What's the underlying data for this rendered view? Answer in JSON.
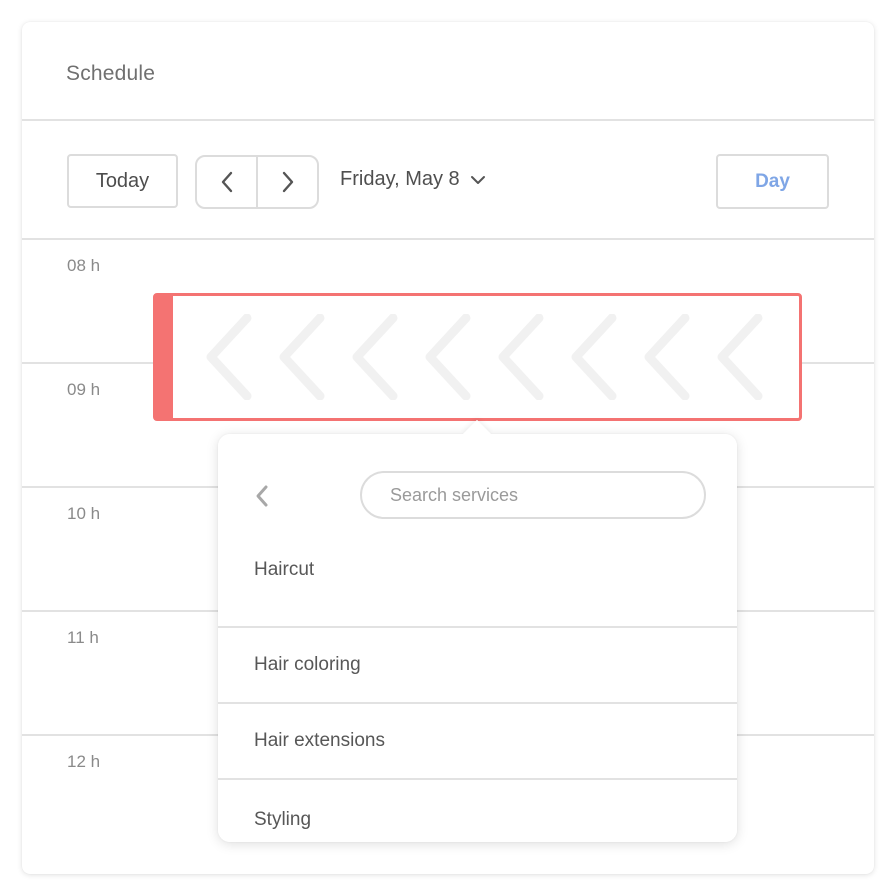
{
  "header": {
    "title": "Schedule"
  },
  "toolbar": {
    "today_label": "Today",
    "prev_icon": "chevron-left-icon",
    "next_icon": "chevron-right-icon",
    "date_label": "Friday, May 8",
    "date_dropdown_icon": "chevron-down-icon",
    "view_label": "Day"
  },
  "hours": [
    "08 h",
    "09 h",
    "10 h",
    "11 h",
    "12 h"
  ],
  "event": {
    "color": "#f47372",
    "pattern_icon": "chevron-left-icon"
  },
  "popover": {
    "back_icon": "chevron-left-icon",
    "search_placeholder": "Search services",
    "services": [
      "Haircut",
      "Hair coloring",
      "Hair extensions",
      "Styling"
    ]
  },
  "colors": {
    "accent": "#7fa6e6",
    "event": "#f47372",
    "border": "#dcdcdc"
  }
}
